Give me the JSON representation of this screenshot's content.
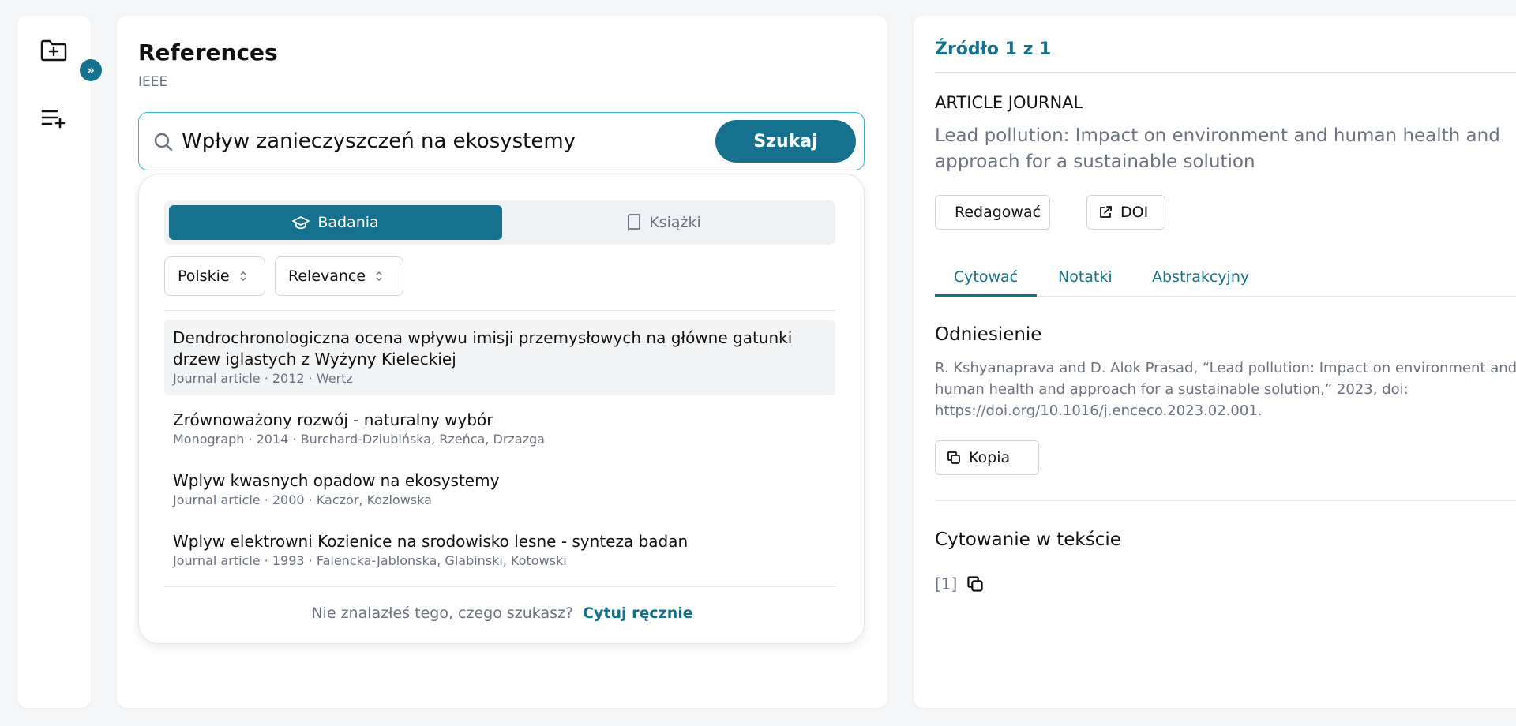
{
  "sidebar": {
    "new_folder_icon": "folder-plus-icon",
    "add_list_icon": "list-plus-icon",
    "expand_symbol": "»"
  },
  "references": {
    "title": "References",
    "style": "IEEE",
    "search": {
      "value": "Wpływ zanieczyszczeń na ekosystemy",
      "button": "Szukaj"
    },
    "tabs": [
      {
        "label": "Badania",
        "active": true
      },
      {
        "label": "Książki",
        "active": false
      }
    ],
    "filters": {
      "language": "Polskie",
      "sort": "Relevance"
    },
    "results": [
      {
        "title": "Dendrochronologiczna ocena wpływu imisji przemysłowych na główne gatunki drzew iglastych z Wyżyny Kieleckiej",
        "meta": "Journal article · 2012 · Wertz"
      },
      {
        "title": "Zrównoważony rozwój - naturalny wybór",
        "meta": "Monograph · 2014 · Burchard-Dziubińska, Rzeńca, Drzazga"
      },
      {
        "title": "Wplyw kwasnych opadow na ekosystemy",
        "meta": "Journal article · 2000 · Kaczor, Kozlowska"
      },
      {
        "title": "Wplyw elektrowni Kozienice na srodowisko lesne - synteza badan",
        "meta": "Journal article · 1993 · Falencka-Jablonska, Glabinski, Kotowski"
      }
    ],
    "footer": {
      "question": "Nie znalazłeś tego, czego szukasz?",
      "link": "Cytuj ręcznie"
    }
  },
  "source": {
    "count": "Źródło 1 z 1",
    "type": "ARTICLE JOURNAL",
    "title": "Lead pollution: Impact on environment and human health and approach for a sustainable solution",
    "edit_button": "Redagować",
    "doi_button": "DOI",
    "tabs": [
      "Cytować",
      "Notatki",
      "Abstrakcyjny"
    ],
    "reference_heading": "Odniesienie",
    "reference_text": "R. Kshyanaprava and D. Alok Prasad, “Lead pollution: Impact on environment and human health and approach for a sustainable solution,” 2023, doi: https://doi.org/10.1016/j.enceco.2023.02.001.",
    "copy_button": "Kopia",
    "intext_heading": "Cytowanie w tekście",
    "intext_value": "[1]"
  },
  "colors": {
    "accent": "#16718f",
    "search_border": "#38b2c8",
    "muted_text": "#6b7280"
  }
}
